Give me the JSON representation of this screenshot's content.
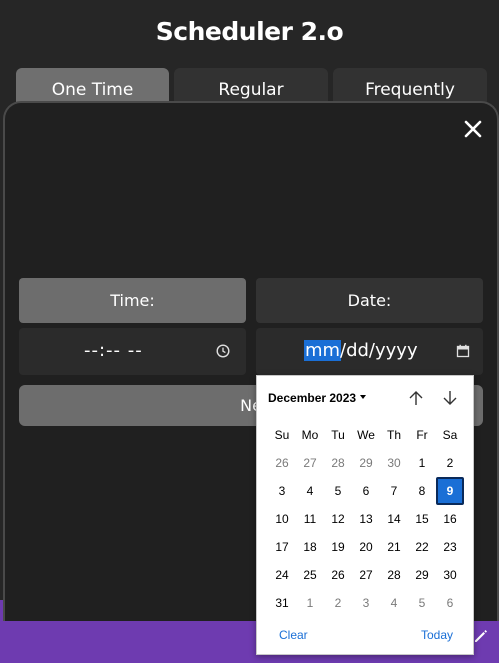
{
  "app": {
    "title": "Scheduler 2.o"
  },
  "tabs": [
    {
      "label": "One Time",
      "active": true
    },
    {
      "label": "Regular",
      "active": false
    },
    {
      "label": "Frequently",
      "active": false
    }
  ],
  "form": {
    "time_label": "Time:",
    "date_label": "Date:",
    "time_value": "--:-- --",
    "date_value_mm": "mm",
    "date_value_rest": "/dd/yyyy",
    "next_label": "Ne"
  },
  "calendar": {
    "month_label": "December 2023",
    "weekdays": [
      "Su",
      "Mo",
      "Tu",
      "We",
      "Th",
      "Fr",
      "Sa"
    ],
    "weeks": [
      [
        "26",
        "27",
        "28",
        "29",
        "30",
        "1",
        "2"
      ],
      [
        "3",
        "4",
        "5",
        "6",
        "7",
        "8",
        "9"
      ],
      [
        "10",
        "11",
        "12",
        "13",
        "14",
        "15",
        "16"
      ],
      [
        "17",
        "18",
        "19",
        "20",
        "21",
        "22",
        "23"
      ],
      [
        "24",
        "25",
        "26",
        "27",
        "28",
        "29",
        "30"
      ],
      [
        "31",
        "1",
        "2",
        "3",
        "4",
        "5",
        "6"
      ]
    ],
    "selected_day": "9",
    "clear_label": "Clear",
    "today_label": "Today"
  },
  "colors": {
    "accent": "#1a6fd6",
    "bottom_bar": "#6e3bb0",
    "background": "#262626"
  },
  "icons": [
    "close-icon",
    "clock-icon",
    "calendar-icon",
    "arrow-up-icon",
    "arrow-down-icon",
    "dropdown-caret-icon",
    "edit-icon"
  ]
}
